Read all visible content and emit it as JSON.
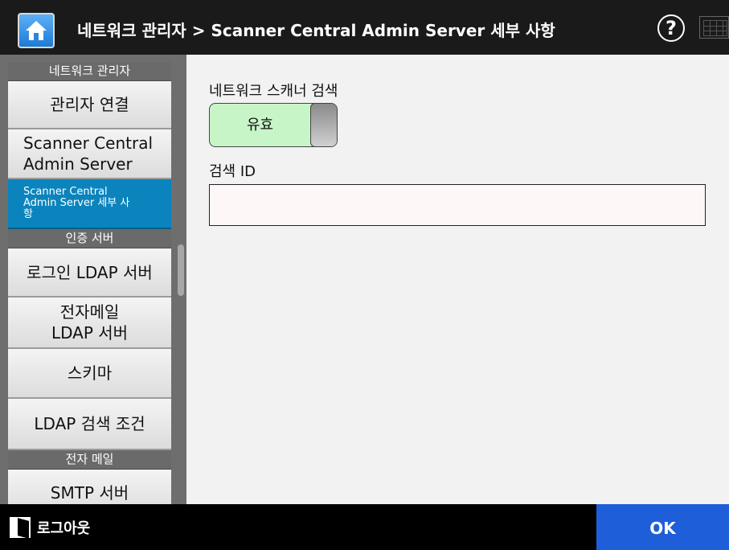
{
  "header": {
    "title": "네트워크 관리자 > Scanner Central Admin Server 세부 사항",
    "help_glyph": "?"
  },
  "sidebar": {
    "sections": [
      {
        "heading": "네트워크 관리자",
        "items": [
          {
            "label": "관리자 연결",
            "active": false
          },
          {
            "label": "Scanner Central\nAdmin Server",
            "active": false
          },
          {
            "label": "Scanner Central\nAdmin Server 세부 사\n항",
            "active": true
          }
        ]
      },
      {
        "heading": "인증 서버",
        "items": [
          {
            "label": "로그인 LDAP 서버",
            "active": false
          },
          {
            "label": "전자메일\nLDAP 서버",
            "active": false
          },
          {
            "label": "스키마",
            "active": false
          },
          {
            "label": "LDAP 검색 조건",
            "active": false
          }
        ]
      },
      {
        "heading": "전자 메일",
        "items": [
          {
            "label": "SMTP 서버",
            "active": false
          }
        ]
      }
    ]
  },
  "main": {
    "network_scanner_search_label": "네트워크 스캐너 검색",
    "toggle_value": "유효",
    "search_id_label": "검색 ID",
    "search_id_value": ""
  },
  "footer": {
    "logout_label": "로그아웃",
    "ok_label": "OK"
  },
  "colors": {
    "active_item": "#0b84bd",
    "ok_button": "#1e5ed8",
    "toggle_on": "#c8f5c8"
  },
  "icons": {
    "home": "home-icon",
    "help": "help-icon",
    "keyboard": "keyboard-icon",
    "logout": "logout-icon"
  }
}
